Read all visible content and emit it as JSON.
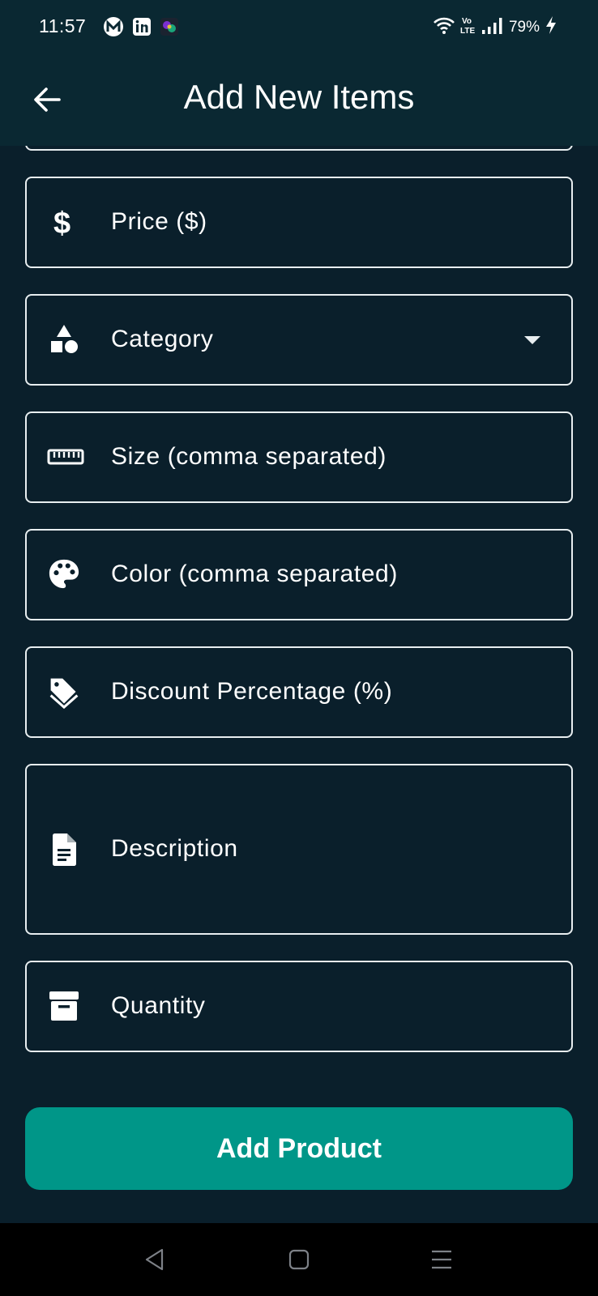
{
  "status_bar": {
    "time": "11:57",
    "battery": "79%",
    "left_icons": [
      "mail-m-icon",
      "linkedin-icon",
      "app-icon"
    ],
    "right_icons": [
      "wifi-icon",
      "volte-icon",
      "signal-icon",
      "charging-icon"
    ],
    "volte_label": "Vo LTE"
  },
  "app_bar": {
    "title": "Add New Items",
    "back_icon": "arrow-back-icon"
  },
  "form": {
    "fields": [
      {
        "id": "price",
        "label": "Price ($)",
        "icon": "dollar-icon"
      },
      {
        "id": "category",
        "label": "Category",
        "icon": "category-shapes-icon",
        "type": "dropdown"
      },
      {
        "id": "size",
        "label": "Size (comma separated)",
        "icon": "ruler-icon"
      },
      {
        "id": "color",
        "label": "Color (comma separated)",
        "icon": "palette-icon"
      },
      {
        "id": "discount",
        "label": "Discount Percentage (%)",
        "icon": "discount-tag-icon"
      },
      {
        "id": "description",
        "label": "Description",
        "icon": "document-icon",
        "multiline": true
      },
      {
        "id": "quantity",
        "label": "Quantity",
        "icon": "inventory-box-icon"
      }
    ],
    "submit_label": "Add Product"
  },
  "colors": {
    "background": "#0a1f2b",
    "app_bar": "#0a2832",
    "field_border": "#e8eef0",
    "button": "#009688",
    "nav_bar": "#000000"
  },
  "nav_bar": {
    "items": [
      "back-triangle-icon",
      "home-square-icon",
      "recents-menu-icon"
    ]
  }
}
